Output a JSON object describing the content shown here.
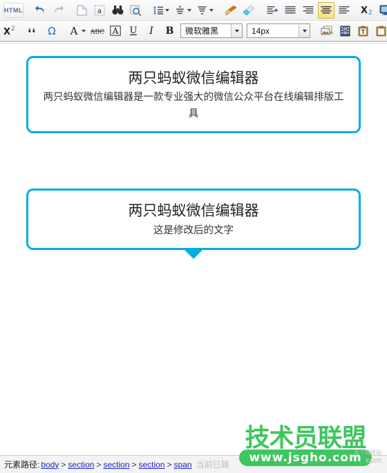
{
  "toolbar": {
    "row1": [
      {
        "name": "html-source-button",
        "label": "HTML",
        "type": "text"
      },
      {
        "name": "separator",
        "type": "sep"
      },
      {
        "name": "undo-icon",
        "label": "↶",
        "type": "icon"
      },
      {
        "name": "redo-icon",
        "label": "↷",
        "type": "icon"
      },
      {
        "name": "separator",
        "type": "sep"
      },
      {
        "name": "new-document-icon",
        "label": "📄",
        "type": "icon"
      },
      {
        "name": "select-all-icon",
        "label": "a",
        "type": "icon"
      },
      {
        "name": "find-binoculars-icon",
        "label": "🔍",
        "type": "icon"
      },
      {
        "name": "search-replace-icon",
        "label": "🔎",
        "type": "icon"
      },
      {
        "name": "separator",
        "type": "sep"
      },
      {
        "name": "line-height-icon",
        "label": "≣",
        "type": "icon",
        "caret": true
      },
      {
        "name": "paragraph-spacing-icon",
        "label": "≡",
        "type": "icon",
        "caret": true
      },
      {
        "name": "indent-spacing-icon",
        "label": "≡",
        "type": "icon",
        "caret": true
      },
      {
        "name": "separator",
        "type": "sep"
      },
      {
        "name": "format-brush-icon",
        "label": "🖌",
        "type": "icon"
      },
      {
        "name": "clear-format-eraser-icon",
        "label": "🧽",
        "type": "icon"
      },
      {
        "name": "separator",
        "type": "sep"
      },
      {
        "name": "indent-increase-icon",
        "label": "⇥",
        "type": "icon"
      },
      {
        "name": "align-justify-icon",
        "label": "≣",
        "type": "icon"
      },
      {
        "name": "align-right-icon",
        "label": "≣",
        "type": "icon"
      },
      {
        "name": "align-center-icon",
        "label": "≣",
        "type": "icon",
        "active": true
      },
      {
        "name": "align-left-icon",
        "label": "≣",
        "type": "icon"
      },
      {
        "name": "separator",
        "type": "sep"
      },
      {
        "name": "subscript-icon",
        "label": "X₂",
        "type": "icon"
      },
      {
        "name": "fullscreen-monitor-icon",
        "label": "🖥",
        "type": "icon"
      }
    ],
    "row2": [
      {
        "name": "superscript-icon",
        "label": "X²",
        "type": "icon"
      },
      {
        "name": "separator",
        "type": "sep"
      },
      {
        "name": "blockquote-icon",
        "label": "❝",
        "type": "icon"
      },
      {
        "name": "special-character-omega-icon",
        "label": "Ω",
        "type": "icon"
      },
      {
        "name": "separator",
        "type": "sep"
      },
      {
        "name": "font-color-icon",
        "label": "A",
        "type": "icon",
        "caret": true
      },
      {
        "name": "strikethrough-icon",
        "label": "ABC",
        "type": "icon"
      },
      {
        "name": "background-color-icon",
        "label": "A",
        "type": "icon"
      },
      {
        "name": "underline-icon",
        "label": "U",
        "type": "icon"
      },
      {
        "name": "italic-icon",
        "label": "I",
        "type": "icon"
      },
      {
        "name": "bold-icon",
        "label": "B",
        "type": "icon"
      }
    ],
    "font_family": {
      "label": "微软雅黑"
    },
    "font_size": {
      "label": "14px"
    },
    "row2_tail": [
      {
        "name": "separator",
        "type": "sep"
      },
      {
        "name": "insert-image-icon",
        "label": "🖼",
        "type": "icon"
      },
      {
        "name": "insert-video-icon",
        "label": "🎞",
        "type": "icon"
      },
      {
        "name": "paste-as-text-icon",
        "label": "📋",
        "type": "icon"
      },
      {
        "name": "paste-icon",
        "label": "📋",
        "type": "icon"
      }
    ]
  },
  "content": {
    "box1": {
      "title": "两只蚂蚁微信编辑器",
      "desc": "两只蚂蚁微信编辑器是一款专业强大的微信公众平台在线编辑排版工具"
    },
    "box2": {
      "title": "两只蚂蚁微信编辑器",
      "desc": "这是修改后的文字"
    },
    "accent_color": "#00aee0"
  },
  "statusbar": {
    "label": "元素路径:",
    "path": [
      "body",
      "section",
      "section",
      "section",
      "span"
    ],
    "separator": ">",
    "trailing": "当前已辑"
  },
  "watermark": {
    "brand": "技术员联盟",
    "url": "www.jsgho.com",
    "sub_top": "爱下载样站",
    "sub_bottom": "com"
  }
}
